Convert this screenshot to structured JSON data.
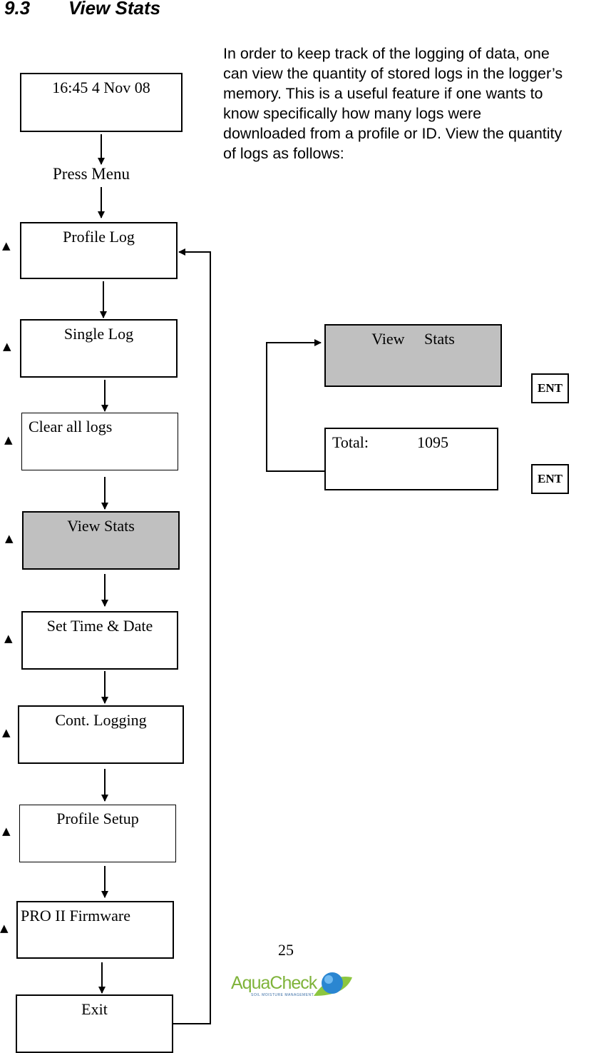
{
  "section": {
    "number": "9.3",
    "title": "View Stats"
  },
  "intro_text": "In order to keep track of the logging of data, one\ncan view the quantity of stored logs in the logger’s\nmemory.  This is a useful feature if one wants to\nknow specifically how many logs were\ndownloaded from a profile or ID.  View the quantity\nof logs as follows:",
  "flowchart": {
    "home_screen": "16:45  4 Nov 08",
    "press_menu": "Press Menu",
    "up_key_glyph": "▲",
    "menu_items": [
      {
        "label": "Profile Log",
        "highlighted": false
      },
      {
        "label": "Single Log",
        "highlighted": false
      },
      {
        "label": "Clear all logs",
        "highlighted": false
      },
      {
        "label": "View Stats",
        "highlighted": true
      },
      {
        "label": "Set Time & Date",
        "highlighted": false
      },
      {
        "label": "Cont. Logging",
        "highlighted": false
      },
      {
        "label": "Profile Setup",
        "highlighted": false
      },
      {
        "label": "PRO II Firmware",
        "highlighted": false
      },
      {
        "label": "Exit",
        "highlighted": false
      }
    ]
  },
  "detail": {
    "view_stats_screen": "View     Stats",
    "total_label": "Total:",
    "total_value": "1095",
    "ent_key_1": "ENT",
    "ent_key_2": "ENT"
  },
  "colors": {
    "highlight": "#c0c0c0"
  },
  "footer": {
    "page_number": "25",
    "logo_text": "AquaCheck",
    "logo_tagline": "SOIL MOISTURE MANAGEMENT"
  }
}
